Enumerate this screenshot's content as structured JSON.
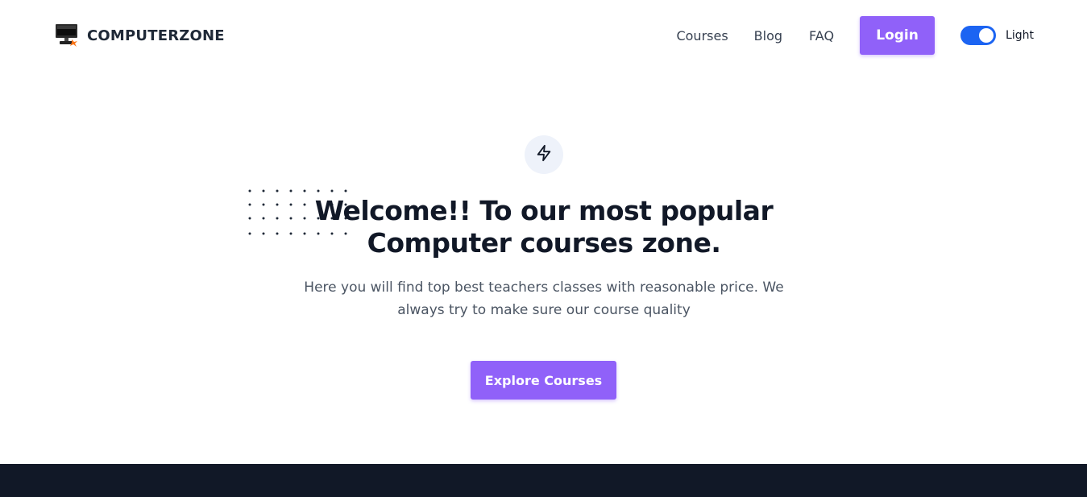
{
  "header": {
    "brand_name": "COMPUTERZONE",
    "logo_icon": "computer-monitor-icon",
    "nav": [
      {
        "label": "Courses"
      },
      {
        "label": "Blog"
      },
      {
        "label": "FAQ"
      }
    ],
    "login_label": "Login",
    "theme_toggle": {
      "label": "Light",
      "on": true
    }
  },
  "hero": {
    "icon": "lightning-bolt-icon",
    "title_line1": "Welcome!! To our most popular",
    "title_line2": "Computer courses zone.",
    "subtitle_line1": "Here you will find top best teachers classes with reasonable price. We",
    "subtitle_line2": "always try to make sure our course quality",
    "cta_label": "Explore Courses"
  },
  "colors": {
    "accent": "#9061f9",
    "toggle": "#1c64f2",
    "text_dark": "#111827",
    "text_muted": "#4b5563",
    "footer_bg": "#111827"
  }
}
